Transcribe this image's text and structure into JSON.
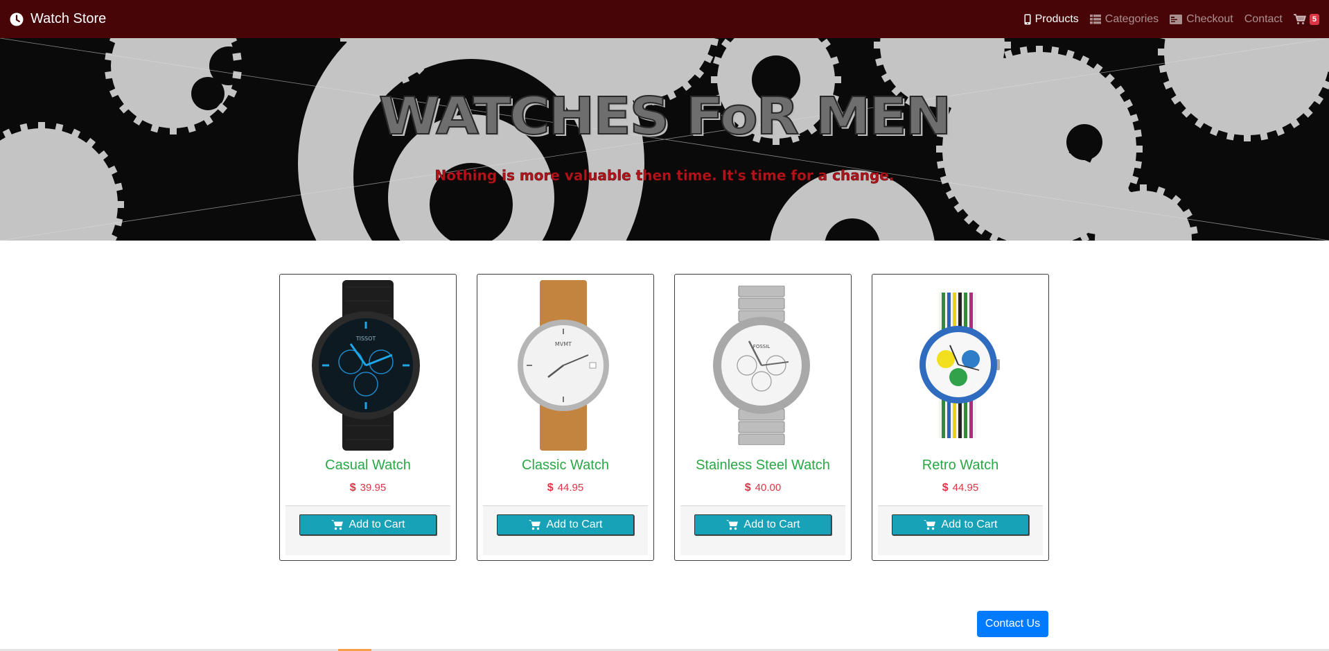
{
  "navbar": {
    "brand": "Watch Store",
    "brand_icon": "clock-icon",
    "items": [
      {
        "label": "Products",
        "icon": "mobile-icon",
        "active": true
      },
      {
        "label": "Categories",
        "icon": "list-icon",
        "active": false
      },
      {
        "label": "Checkout",
        "icon": "id-card-icon",
        "active": false
      },
      {
        "label": "Contact",
        "icon": "",
        "active": false
      }
    ],
    "cart_count": "5",
    "colors": {
      "background": "#470508",
      "badge": "#dc3545"
    }
  },
  "hero": {
    "title": "WATCHES FoR MEN",
    "subtitle": "Nothing is more valuable then time. It's time for a change."
  },
  "products": [
    {
      "name": "Casual Watch",
      "currency": "$",
      "price": "39.95",
      "button": "Add to Cart",
      "image": "black-blue-chronograph-watch"
    },
    {
      "name": "Classic Watch",
      "currency": "$",
      "price": "44.95",
      "button": "Add to Cart",
      "image": "white-dial-brown-strap-watch"
    },
    {
      "name": "Stainless Steel Watch",
      "currency": "$",
      "price": "40.00",
      "button": "Add to Cart",
      "image": "steel-chronograph-watch"
    },
    {
      "name": "Retro Watch",
      "currency": "$",
      "price": "44.95",
      "button": "Add to Cart",
      "image": "colorful-nato-strap-watch"
    }
  ],
  "contact_button": "Contact Us",
  "colors": {
    "product_name": "#28a745",
    "price": "#dc3545",
    "cart_button": "#17a2b8",
    "contact_button": "#007bff"
  }
}
